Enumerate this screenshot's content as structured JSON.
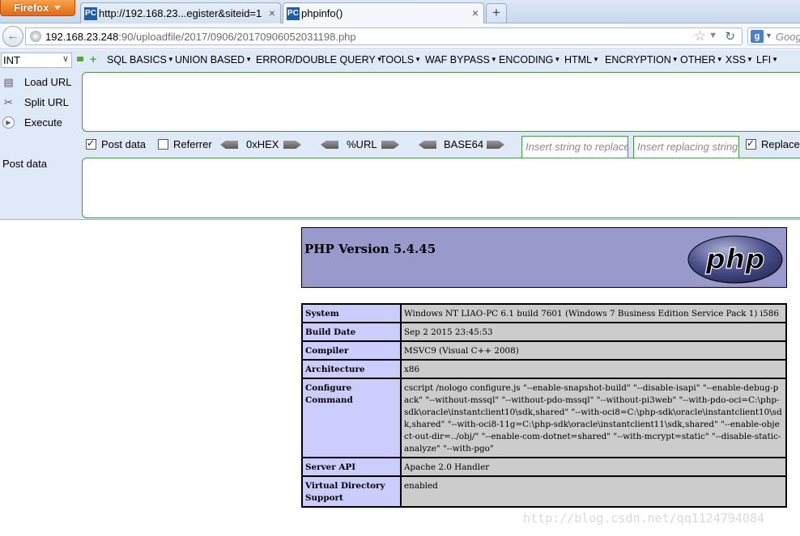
{
  "browser": {
    "menu_button": "Firefox",
    "tabs": [
      {
        "icon": "PC",
        "title": "http://192.168.23...egister&siteid=1",
        "close": "×"
      },
      {
        "icon": "PC",
        "title": "phpinfo()",
        "close": "×"
      }
    ],
    "new_tab": "+",
    "url_host": "192.168.23.248",
    "url_path": ":90/uploadfile/2017/0906/20170906052031198.php",
    "search_engine_icon": "g",
    "search_placeholder": "Goog"
  },
  "hackbar": {
    "select_value": "INT",
    "menus": [
      "SQL BASICS",
      "UNION BASED",
      "ERROR/DOUBLE QUERY",
      "TOOLS",
      "WAF BYPASS",
      "ENCODING",
      "HTML",
      "ENCRYPTION",
      "OTHER",
      "XSS",
      "LFI"
    ],
    "side_actions": [
      "Load URL",
      "Split URL",
      "Execute"
    ],
    "options": {
      "post_data": {
        "label": "Post data",
        "checked": true
      },
      "referrer": {
        "label": "Referrer",
        "checked": false
      },
      "hex": "0xHEX",
      "url": "%URL",
      "base64": "BASE64",
      "replace_placeholder_1": "Insert string to replace",
      "replace_placeholder_2": "Insert replacing string",
      "replace": {
        "label": "Replace",
        "checked": true
      }
    },
    "post_label": "Post data"
  },
  "phpinfo": {
    "version": "PHP Version 5.4.45",
    "logo_text": "php",
    "rows": [
      {
        "key": "System",
        "value": "Windows NT LIAO-PC 6.1 build 7601 (Windows 7 Business Edition Service Pack 1) i586"
      },
      {
        "key": "Build Date",
        "value": "Sep 2 2015 23:45:53"
      },
      {
        "key": "Compiler",
        "value": "MSVC9 (Visual C++ 2008)"
      },
      {
        "key": "Architecture",
        "value": "x86"
      },
      {
        "key": "Configure Command",
        "value": "cscript /nologo configure.js \"--enable-snapshot-build\" \"--disable-isapi\" \"--enable-debug-pack\" \"--without-mssql\" \"--without-pdo-mssql\" \"--without-pi3web\" \"--with-pdo-oci=C:\\php-sdk\\oracle\\instantclient10\\sdk,shared\" \"--with-oci8=C:\\php-sdk\\oracle\\instantclient10\\sdk,shared\" \"--with-oci8-11g=C:\\php-sdk\\oracle\\instantclient11\\sdk,shared\" \"--enable-object-out-dir=../obj/\" \"--enable-com-dotnet=shared\" \"--with-mcrypt=static\" \"--disable-static-analyze\" \"--with-pgo\""
      },
      {
        "key": "Server API",
        "value": "Apache 2.0 Handler"
      },
      {
        "key": "Virtual Directory Support",
        "value": "enabled"
      }
    ]
  },
  "watermark": "http://blog.csdn.net/qq1124794084"
}
